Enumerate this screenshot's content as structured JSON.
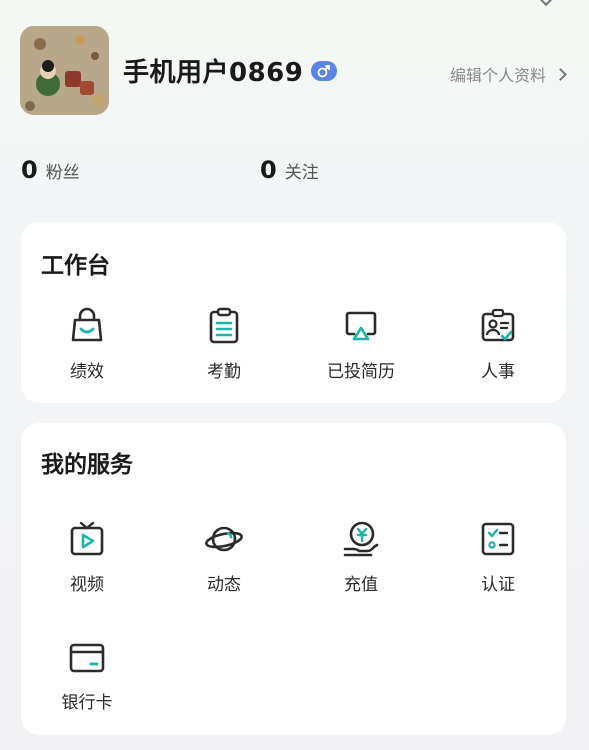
{
  "profile": {
    "username": "手机用户0869",
    "gender_icon": "male-icon",
    "edit_label": "编辑个人资料"
  },
  "stats": {
    "fans_count": "0",
    "fans_label": "粉丝",
    "follow_count": "0",
    "follow_label": "关注"
  },
  "workbench": {
    "title": "工作台",
    "items": [
      {
        "label": "绩效",
        "icon": "shopping-bag-icon"
      },
      {
        "label": "考勤",
        "icon": "clipboard-icon"
      },
      {
        "label": "已投简历",
        "icon": "upload-tray-icon"
      },
      {
        "label": "人事",
        "icon": "id-card-icon"
      }
    ]
  },
  "services": {
    "title": "我的服务",
    "items": [
      {
        "label": "视频",
        "icon": "tv-play-icon"
      },
      {
        "label": "动态",
        "icon": "planet-icon"
      },
      {
        "label": "充值",
        "icon": "yuan-coin-hand-icon"
      },
      {
        "label": "认证",
        "icon": "checklist-icon"
      },
      {
        "label": "银行卡",
        "icon": "bank-card-icon"
      }
    ]
  },
  "colors": {
    "accent": "#1bb5a8",
    "icon_stroke": "#2b2b2b",
    "gender_badge": "#5b84e8",
    "card_bg": "#ffffff"
  }
}
